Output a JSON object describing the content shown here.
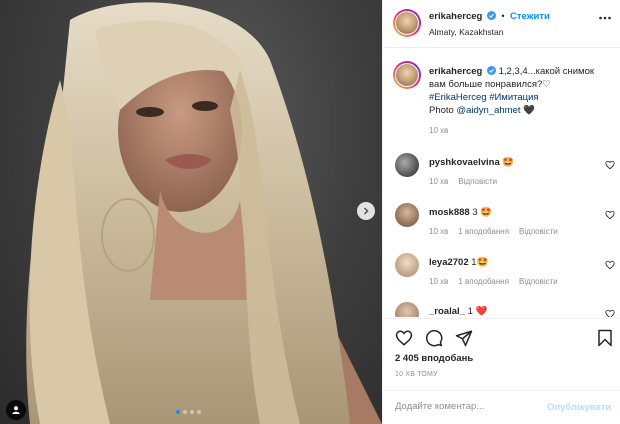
{
  "header": {
    "username": "erikaherceg",
    "follow_label": "Стежити",
    "location": "Almaty, Kazakhstan"
  },
  "caption": {
    "username": "erikaherceg",
    "text": "1,2,3,4...какой снимок вам больше понравился?♡",
    "hashtags": "#ErikaHerceg #Имитация",
    "photo_prefix": "Photo",
    "photo_mention": "@aidyn_ahmet",
    "photo_suffix": "🖤",
    "time": "10 хв"
  },
  "comments": [
    {
      "username": "pyshkovaelvina",
      "text": "🤩",
      "time": "10 хв",
      "likes": "",
      "reply": "Відповісти"
    },
    {
      "username": "mosk888",
      "text": "3 🤩",
      "time": "10 хв",
      "likes": "1 вподобання",
      "reply": "Відповісти"
    },
    {
      "username": "leya2702",
      "text": "1🤩",
      "time": "10 хв",
      "likes": "1 вподобання",
      "reply": "Відповісти"
    },
    {
      "username": "_roalal_",
      "text": "1 ❤️",
      "time": "",
      "likes": "",
      "reply": ""
    }
  ],
  "actions": {
    "likes_count": "2 405 вподобань",
    "posted_time": "10 ХВ ТОМУ"
  },
  "add_comment": {
    "placeholder": "Додайте коментар...",
    "publish_label": "Опублікувати"
  },
  "carousel": {
    "total": 4,
    "active": 1
  },
  "colors": {
    "accent": "#0095f6",
    "link": "#00376b",
    "muted": "#8e8e8e",
    "publish_disabled": "#b2dffc"
  }
}
